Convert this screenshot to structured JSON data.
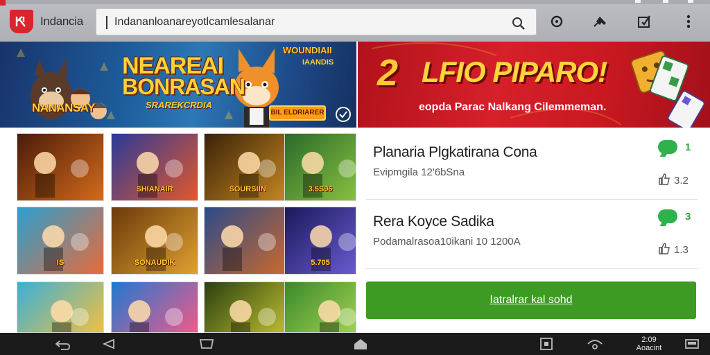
{
  "browser": {
    "brand": "Indancia",
    "url": "Indananloanareyotlcamlesalanar"
  },
  "banners": {
    "left": {
      "title_line1": "NEAREAI",
      "title_line2": "BONRASAN",
      "subtitle": "SRAREKCRDIA",
      "character_name": "NANANSAY",
      "corner_line1": "WOUNDIAII",
      "corner_line2": "IAANDIS",
      "button": "BIL ELDRIARER"
    },
    "right": {
      "number": "2",
      "title": "LFIO PIPARO!",
      "subtitle": "eopda Parac Nalkang Cilemmeman."
    }
  },
  "game_tiles": [
    {
      "label": "",
      "colors": [
        "#4a1c0a",
        "#d46a1a"
      ]
    },
    {
      "label": "SHIANAIR",
      "colors": [
        "#2a3a9a",
        "#e2582a"
      ]
    },
    {
      "label": "SOURSIIN",
      "colors": [
        "#3a2208",
        "#c98a22"
      ]
    },
    {
      "label": "3.5S96",
      "colors": [
        "#2a6a2a",
        "#88c040"
      ]
    },
    {
      "label": "IS",
      "colors": [
        "#2aa0d0",
        "#e86a3a"
      ]
    },
    {
      "label": "SONAUDIK",
      "colors": [
        "#6a3a0a",
        "#e0a030"
      ]
    },
    {
      "label": "",
      "colors": [
        "#2a4a8a",
        "#d06a2a"
      ]
    },
    {
      "label": "5.705",
      "colors": [
        "#1a1a5a",
        "#6a5ad0"
      ]
    },
    {
      "label": "",
      "colors": [
        "#3ab0d8",
        "#f0c040"
      ]
    },
    {
      "label": "",
      "colors": [
        "#1e7ad0",
        "#f05a8a"
      ]
    },
    {
      "label": "",
      "colors": [
        "#2a4010",
        "#c0c030"
      ]
    },
    {
      "label": "",
      "colors": [
        "#3a8a2a",
        "#a0d050"
      ]
    }
  ],
  "list": [
    {
      "title": "Planaria Plgkatirana Cona",
      "meta": "Evipmgila 12'6bSna",
      "comments": "1",
      "likes": "3.2"
    },
    {
      "title": "Rera Koyce Sadika",
      "meta": "Podamalrasoa10ikani  10 1200A",
      "comments": "3",
      "likes": "1.3"
    }
  ],
  "cta_label": "Iatralrar kal sohd",
  "nav": {
    "clock_line1": "2:09",
    "clock_line2": "Aoacint"
  },
  "colors": {
    "accent_green": "#3d9b23",
    "brand_red": "#d8262c"
  }
}
